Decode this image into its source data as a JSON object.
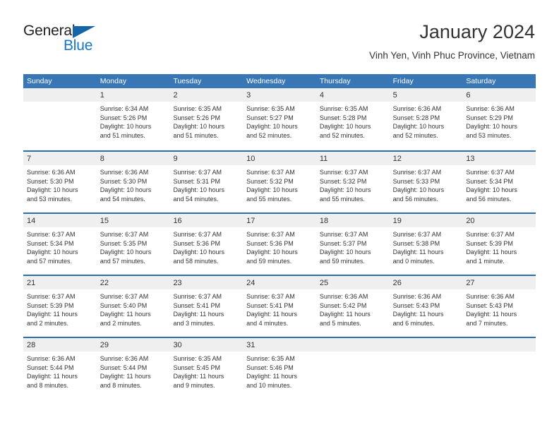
{
  "brand": {
    "name_top": "General",
    "name_bottom": "Blue",
    "accent_color": "#1877c4",
    "triangle_color": "#1565a8"
  },
  "header": {
    "title": "January 2024",
    "location": "Vinh Yen, Vinh Phuc Province, Vietnam"
  },
  "calendar": {
    "header_bg": "#3876b6",
    "row_divider_color": "#2a6ead",
    "day_band_bg": "#efefef",
    "weekdays": [
      "Sunday",
      "Monday",
      "Tuesday",
      "Wednesday",
      "Thursday",
      "Friday",
      "Saturday"
    ],
    "weeks": [
      [
        {
          "day": "",
          "sunrise": "",
          "sunset": "",
          "daylight_line1": "",
          "daylight_line2": "",
          "empty": true
        },
        {
          "day": "1",
          "sunrise": "Sunrise: 6:34 AM",
          "sunset": "Sunset: 5:26 PM",
          "daylight_line1": "Daylight: 10 hours",
          "daylight_line2": "and 51 minutes."
        },
        {
          "day": "2",
          "sunrise": "Sunrise: 6:35 AM",
          "sunset": "Sunset: 5:26 PM",
          "daylight_line1": "Daylight: 10 hours",
          "daylight_line2": "and 51 minutes."
        },
        {
          "day": "3",
          "sunrise": "Sunrise: 6:35 AM",
          "sunset": "Sunset: 5:27 PM",
          "daylight_line1": "Daylight: 10 hours",
          "daylight_line2": "and 52 minutes."
        },
        {
          "day": "4",
          "sunrise": "Sunrise: 6:35 AM",
          "sunset": "Sunset: 5:28 PM",
          "daylight_line1": "Daylight: 10 hours",
          "daylight_line2": "and 52 minutes."
        },
        {
          "day": "5",
          "sunrise": "Sunrise: 6:36 AM",
          "sunset": "Sunset: 5:28 PM",
          "daylight_line1": "Daylight: 10 hours",
          "daylight_line2": "and 52 minutes."
        },
        {
          "day": "6",
          "sunrise": "Sunrise: 6:36 AM",
          "sunset": "Sunset: 5:29 PM",
          "daylight_line1": "Daylight: 10 hours",
          "daylight_line2": "and 53 minutes."
        }
      ],
      [
        {
          "day": "7",
          "sunrise": "Sunrise: 6:36 AM",
          "sunset": "Sunset: 5:30 PM",
          "daylight_line1": "Daylight: 10 hours",
          "daylight_line2": "and 53 minutes."
        },
        {
          "day": "8",
          "sunrise": "Sunrise: 6:36 AM",
          "sunset": "Sunset: 5:30 PM",
          "daylight_line1": "Daylight: 10 hours",
          "daylight_line2": "and 54 minutes."
        },
        {
          "day": "9",
          "sunrise": "Sunrise: 6:37 AM",
          "sunset": "Sunset: 5:31 PM",
          "daylight_line1": "Daylight: 10 hours",
          "daylight_line2": "and 54 minutes."
        },
        {
          "day": "10",
          "sunrise": "Sunrise: 6:37 AM",
          "sunset": "Sunset: 5:32 PM",
          "daylight_line1": "Daylight: 10 hours",
          "daylight_line2": "and 55 minutes."
        },
        {
          "day": "11",
          "sunrise": "Sunrise: 6:37 AM",
          "sunset": "Sunset: 5:32 PM",
          "daylight_line1": "Daylight: 10 hours",
          "daylight_line2": "and 55 minutes."
        },
        {
          "day": "12",
          "sunrise": "Sunrise: 6:37 AM",
          "sunset": "Sunset: 5:33 PM",
          "daylight_line1": "Daylight: 10 hours",
          "daylight_line2": "and 56 minutes."
        },
        {
          "day": "13",
          "sunrise": "Sunrise: 6:37 AM",
          "sunset": "Sunset: 5:34 PM",
          "daylight_line1": "Daylight: 10 hours",
          "daylight_line2": "and 56 minutes."
        }
      ],
      [
        {
          "day": "14",
          "sunrise": "Sunrise: 6:37 AM",
          "sunset": "Sunset: 5:34 PM",
          "daylight_line1": "Daylight: 10 hours",
          "daylight_line2": "and 57 minutes."
        },
        {
          "day": "15",
          "sunrise": "Sunrise: 6:37 AM",
          "sunset": "Sunset: 5:35 PM",
          "daylight_line1": "Daylight: 10 hours",
          "daylight_line2": "and 57 minutes."
        },
        {
          "day": "16",
          "sunrise": "Sunrise: 6:37 AM",
          "sunset": "Sunset: 5:36 PM",
          "daylight_line1": "Daylight: 10 hours",
          "daylight_line2": "and 58 minutes."
        },
        {
          "day": "17",
          "sunrise": "Sunrise: 6:37 AM",
          "sunset": "Sunset: 5:36 PM",
          "daylight_line1": "Daylight: 10 hours",
          "daylight_line2": "and 59 minutes."
        },
        {
          "day": "18",
          "sunrise": "Sunrise: 6:37 AM",
          "sunset": "Sunset: 5:37 PM",
          "daylight_line1": "Daylight: 10 hours",
          "daylight_line2": "and 59 minutes."
        },
        {
          "day": "19",
          "sunrise": "Sunrise: 6:37 AM",
          "sunset": "Sunset: 5:38 PM",
          "daylight_line1": "Daylight: 11 hours",
          "daylight_line2": "and 0 minutes."
        },
        {
          "day": "20",
          "sunrise": "Sunrise: 6:37 AM",
          "sunset": "Sunset: 5:39 PM",
          "daylight_line1": "Daylight: 11 hours",
          "daylight_line2": "and 1 minute."
        }
      ],
      [
        {
          "day": "21",
          "sunrise": "Sunrise: 6:37 AM",
          "sunset": "Sunset: 5:39 PM",
          "daylight_line1": "Daylight: 11 hours",
          "daylight_line2": "and 2 minutes."
        },
        {
          "day": "22",
          "sunrise": "Sunrise: 6:37 AM",
          "sunset": "Sunset: 5:40 PM",
          "daylight_line1": "Daylight: 11 hours",
          "daylight_line2": "and 2 minutes."
        },
        {
          "day": "23",
          "sunrise": "Sunrise: 6:37 AM",
          "sunset": "Sunset: 5:41 PM",
          "daylight_line1": "Daylight: 11 hours",
          "daylight_line2": "and 3 minutes."
        },
        {
          "day": "24",
          "sunrise": "Sunrise: 6:37 AM",
          "sunset": "Sunset: 5:41 PM",
          "daylight_line1": "Daylight: 11 hours",
          "daylight_line2": "and 4 minutes."
        },
        {
          "day": "25",
          "sunrise": "Sunrise: 6:36 AM",
          "sunset": "Sunset: 5:42 PM",
          "daylight_line1": "Daylight: 11 hours",
          "daylight_line2": "and 5 minutes."
        },
        {
          "day": "26",
          "sunrise": "Sunrise: 6:36 AM",
          "sunset": "Sunset: 5:43 PM",
          "daylight_line1": "Daylight: 11 hours",
          "daylight_line2": "and 6 minutes."
        },
        {
          "day": "27",
          "sunrise": "Sunrise: 6:36 AM",
          "sunset": "Sunset: 5:43 PM",
          "daylight_line1": "Daylight: 11 hours",
          "daylight_line2": "and 7 minutes."
        }
      ],
      [
        {
          "day": "28",
          "sunrise": "Sunrise: 6:36 AM",
          "sunset": "Sunset: 5:44 PM",
          "daylight_line1": "Daylight: 11 hours",
          "daylight_line2": "and 8 minutes."
        },
        {
          "day": "29",
          "sunrise": "Sunrise: 6:36 AM",
          "sunset": "Sunset: 5:44 PM",
          "daylight_line1": "Daylight: 11 hours",
          "daylight_line2": "and 8 minutes."
        },
        {
          "day": "30",
          "sunrise": "Sunrise: 6:35 AM",
          "sunset": "Sunset: 5:45 PM",
          "daylight_line1": "Daylight: 11 hours",
          "daylight_line2": "and 9 minutes."
        },
        {
          "day": "31",
          "sunrise": "Sunrise: 6:35 AM",
          "sunset": "Sunset: 5:46 PM",
          "daylight_line1": "Daylight: 11 hours",
          "daylight_line2": "and 10 minutes."
        },
        {
          "day": "",
          "sunrise": "",
          "sunset": "",
          "daylight_line1": "",
          "daylight_line2": "",
          "empty": true
        },
        {
          "day": "",
          "sunrise": "",
          "sunset": "",
          "daylight_line1": "",
          "daylight_line2": "",
          "empty": true
        },
        {
          "day": "",
          "sunrise": "",
          "sunset": "",
          "daylight_line1": "",
          "daylight_line2": "",
          "empty": true
        }
      ]
    ]
  }
}
